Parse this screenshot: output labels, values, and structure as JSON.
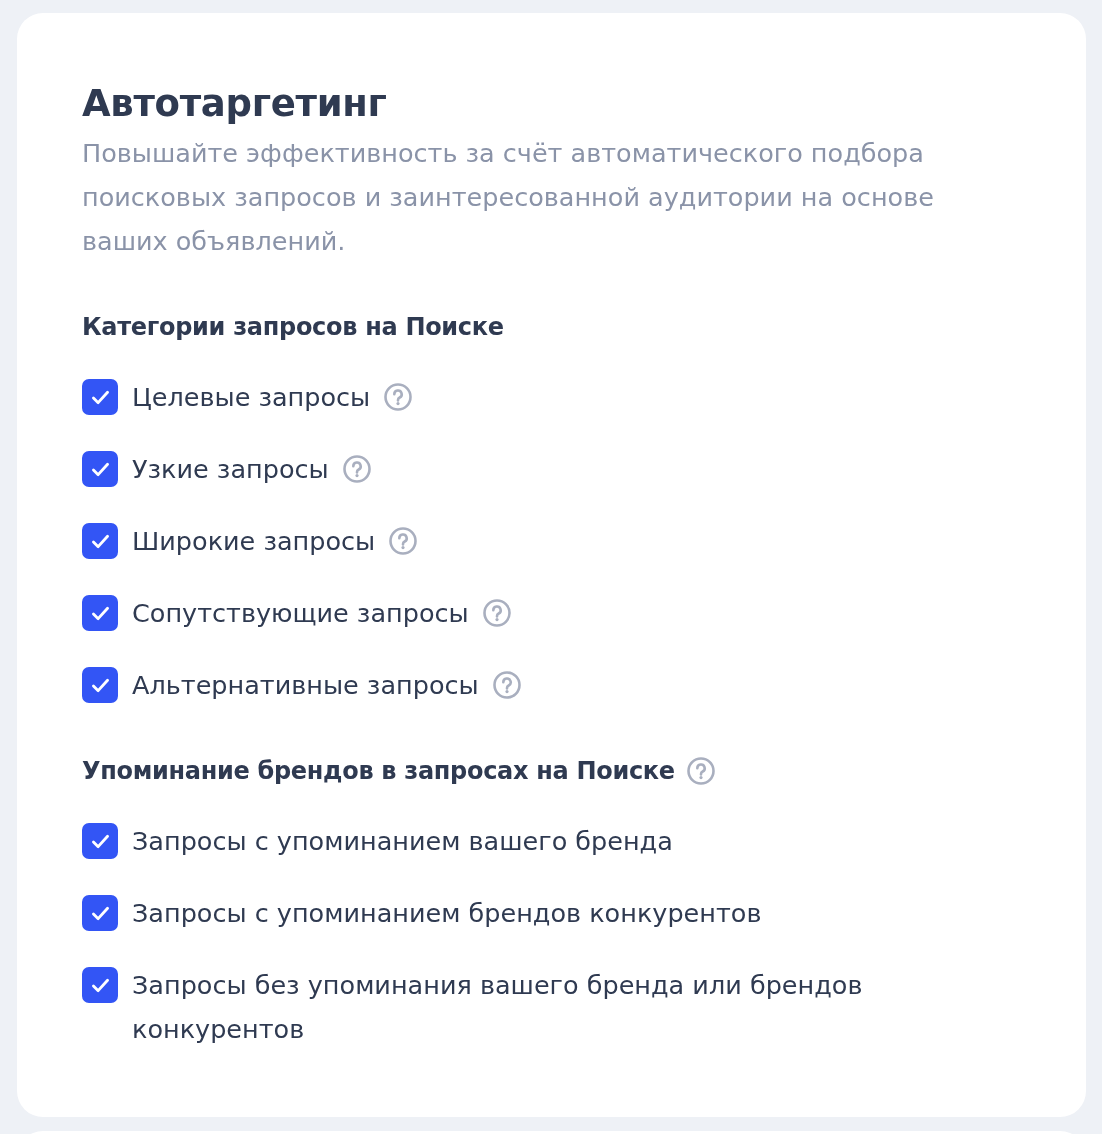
{
  "card": {
    "title": "Автотаргетинг",
    "description": "Повышайте эффективность за счёт автоматического подбора поисковых запросов и заинтересованной аудитории на основе ваших объявлений."
  },
  "sections": [
    {
      "heading": "Категории запросов на Поиске",
      "help": false,
      "options": [
        {
          "label": "Целевые запросы",
          "checked": true,
          "help": true
        },
        {
          "label": "Узкие запросы",
          "checked": true,
          "help": true
        },
        {
          "label": "Широкие запросы",
          "checked": true,
          "help": true
        },
        {
          "label": "Сопутствующие запросы",
          "checked": true,
          "help": true
        },
        {
          "label": "Альтернативные запросы",
          "checked": true,
          "help": true
        }
      ]
    },
    {
      "heading": "Упоминание брендов в запросах на Поиске",
      "help": true,
      "options": [
        {
          "label": "Запросы с упоминанием вашего бренда",
          "checked": true,
          "help": false
        },
        {
          "label": "Запросы с упоминанием брендов конкурентов",
          "checked": true,
          "help": false
        },
        {
          "label": "Запросы без упоминания вашего бренда или брендов конкурентов",
          "checked": true,
          "help": false
        }
      ]
    }
  ]
}
